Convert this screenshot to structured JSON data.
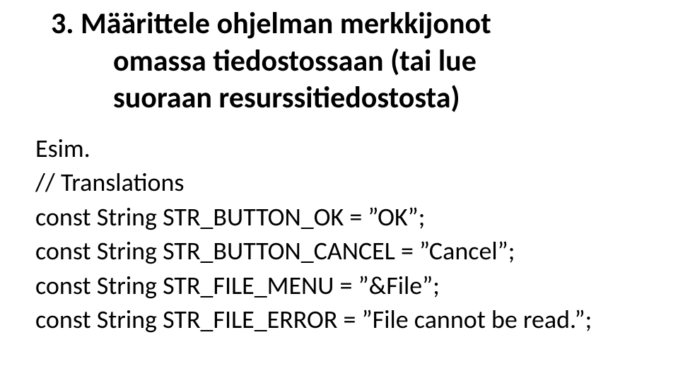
{
  "heading": {
    "line1_prefix": "3. ",
    "line1_text": "Määrittele ohjelman merkkijonot",
    "line2_text": "omassa tiedostossaan (tai lue",
    "line3_text": "suoraan resurssitiedostosta)"
  },
  "code": {
    "label": "Esim.",
    "comment": "// Translations",
    "line1": "const String STR_BUTTON_OK = ”OK”;",
    "line2": "const String STR_BUTTON_CANCEL = ”Cancel”;",
    "line3": "const String STR_FILE_MENU = ”&File”;",
    "line4": "const String STR_FILE_ERROR = ”File cannot be read.”;"
  }
}
